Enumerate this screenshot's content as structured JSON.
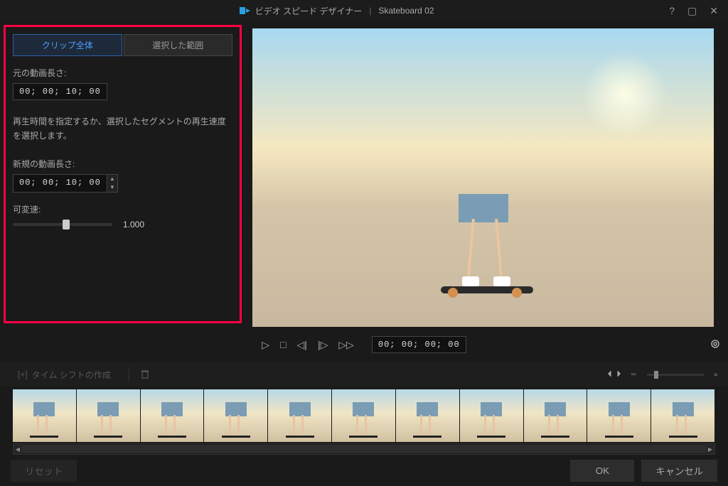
{
  "titlebar": {
    "app_name": "ビデオ スピード デザイナー",
    "separator": "|",
    "file_name": "Skateboard 02"
  },
  "tabs": {
    "clip_full": "クリップ全体",
    "selected_range": "選択した範囲"
  },
  "panel": {
    "orig_label": "元の動画長さ:",
    "orig_value": "00; 00; 10; 00",
    "desc": "再生時間を指定するか、選択したセグメントの再生速度を選択します。",
    "new_label": "新規の動画長さ:",
    "new_value": "00; 00; 10; 00",
    "speed_label": "可変速:",
    "speed_value": "1.000"
  },
  "controls": {
    "timecode": "00; 00; 00; 00"
  },
  "tools": {
    "timeshift_create": "タイム シフトの作成"
  },
  "footer": {
    "reset": "リセット",
    "ok": "OK",
    "cancel": "キャンセル"
  }
}
